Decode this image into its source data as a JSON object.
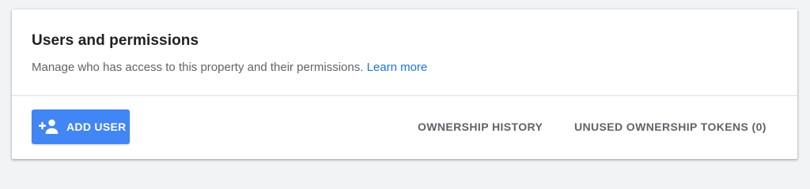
{
  "header": {
    "title": "Users and permissions",
    "description": "Manage who has access to this property and their permissions.",
    "learn_more_label": "Learn more"
  },
  "actions": {
    "add_user_label": "ADD USER",
    "add_user_icon": "person-add-icon",
    "ownership_history_label": "OWNERSHIP HISTORY",
    "unused_tokens_label": "UNUSED OWNERSHIP TOKENS (0)"
  },
  "colors": {
    "primary_button": "#4285f4",
    "link": "#1a73e8",
    "text_secondary": "#5f6368",
    "page_background": "#f1f3f4"
  }
}
